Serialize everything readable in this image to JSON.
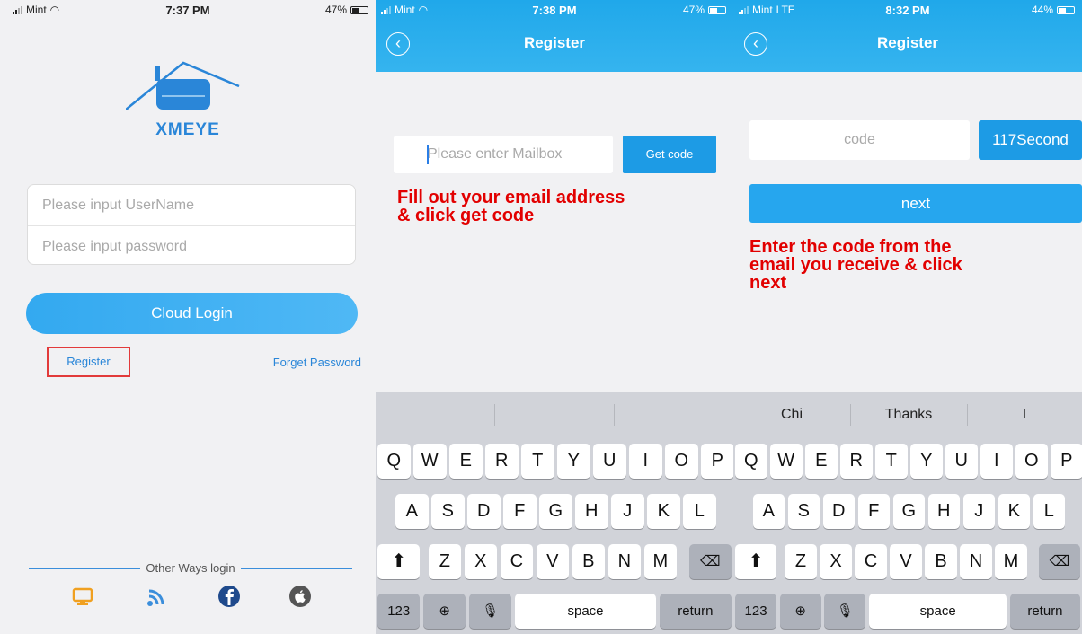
{
  "screen1": {
    "status": {
      "carrier": "Mint",
      "time": "7:37 PM",
      "battery": "47%"
    },
    "logo_text": "XMEYE",
    "username_placeholder": "Please input UserName",
    "password_placeholder": "Please input password",
    "cloud_login": "Cloud Login",
    "register": "Register",
    "forget_password": "Forget Password",
    "other_ways": "Other Ways login",
    "login_icons": [
      "monitor-icon",
      "wifi-icon",
      "facebook-icon",
      "apple-icon"
    ]
  },
  "screen2": {
    "status": {
      "carrier": "Mint",
      "time": "7:38 PM",
      "battery": "47%"
    },
    "title": "Register",
    "mailbox_placeholder": "Please enter Mailbox",
    "get_code": "Get code",
    "note_line1": "Fill out your email address",
    "note_line2": "& click get code"
  },
  "screen3": {
    "status": {
      "carrier": "Mint",
      "network": "LTE",
      "time": "8:32 PM",
      "battery": "44%"
    },
    "title": "Register",
    "code_placeholder": "code",
    "countdown": "117Second",
    "next": "next",
    "note_line1": "Enter the code from the",
    "note_line2": "email you receive & click",
    "note_line3": "next"
  },
  "keyboard": {
    "suggestions": [
      "Chi",
      "Thanks",
      "I"
    ],
    "row1": [
      "Q",
      "W",
      "E",
      "R",
      "T",
      "Y",
      "U",
      "I",
      "O",
      "P"
    ],
    "row2": [
      "A",
      "S",
      "D",
      "F",
      "G",
      "H",
      "J",
      "K",
      "L"
    ],
    "row3": [
      "Z",
      "X",
      "C",
      "V",
      "B",
      "N",
      "M"
    ],
    "numbers": "123",
    "space": "space",
    "return": "return"
  },
  "colors": {
    "accent": "#1d9be5",
    "note_red": "#e20000",
    "link_blue": "#2a86d8",
    "keyboard_bg": "#d1d3d9"
  }
}
